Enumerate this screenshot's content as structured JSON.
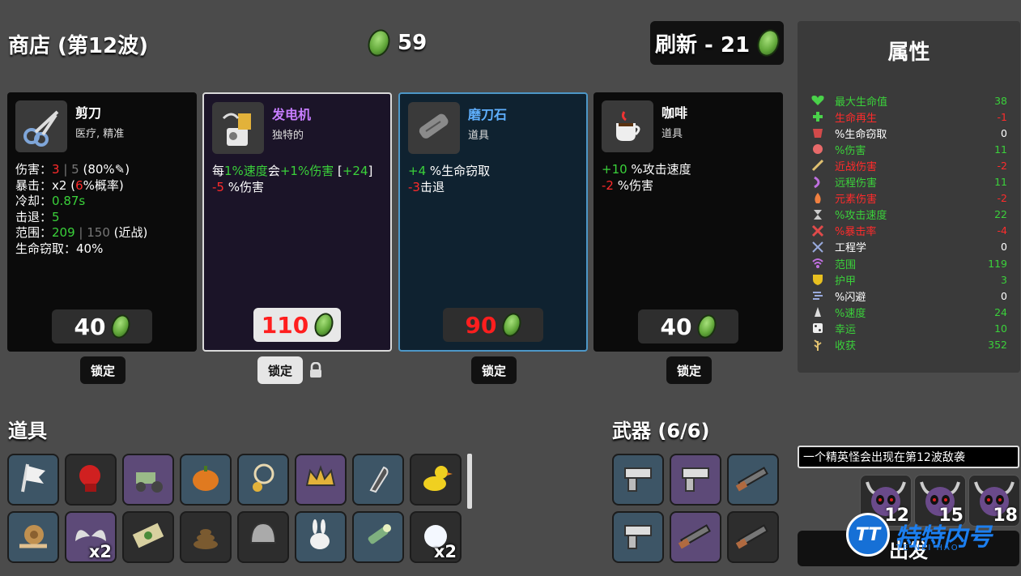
{
  "header": {
    "title": "商店 (第12波)",
    "gold": "59",
    "reroll_label": "刷新 - 21"
  },
  "shop": [
    {
      "name": "剪刀",
      "tags": "医疗, 精准",
      "icon": "scissors-icon",
      "price": "40",
      "lock_label": "锁定",
      "locked": false,
      "rarity": "common",
      "stats": [
        {
          "label": "伤害：",
          "parts": [
            {
              "t": "3",
              "c": "r"
            },
            {
              "t": " | ",
              "c": "dim"
            },
            {
              "t": "5",
              "c": "dim"
            },
            {
              "t": " (80%",
              "c": ""
            },
            {
              "t": "✎",
              "c": ""
            },
            {
              "t": ")",
              "c": ""
            }
          ]
        },
        {
          "label": "暴击：",
          "parts": [
            {
              "t": "x2 (",
              "c": ""
            },
            {
              "t": "6",
              "c": "r"
            },
            {
              "t": "%概率)",
              "c": ""
            }
          ]
        },
        {
          "label": "冷却：",
          "parts": [
            {
              "t": "0.87s",
              "c": "g"
            }
          ]
        },
        {
          "label": "击退：",
          "parts": [
            {
              "t": "5",
              "c": "g"
            }
          ]
        },
        {
          "label": "范围：",
          "parts": [
            {
              "t": "209",
              "c": "g"
            },
            {
              "t": " | 150",
              "c": "dim"
            },
            {
              "t": " (近战)",
              "c": ""
            }
          ]
        },
        {
          "label": "生命窃取：",
          "parts": [
            {
              "t": "40%",
              "c": ""
            }
          ]
        }
      ]
    },
    {
      "name": "发电机",
      "tags": "独特的",
      "icon": "generator-icon",
      "price": "110",
      "lock_label": "锁定",
      "locked": true,
      "rarity": "legendary",
      "stats": [
        {
          "label": "",
          "parts": [
            {
              "t": "每",
              "c": ""
            },
            {
              "t": "1%速度",
              "c": "g"
            },
            {
              "t": "会",
              "c": ""
            },
            {
              "t": "+1%伤害",
              "c": "g"
            },
            {
              "t": " [",
              "c": ""
            },
            {
              "t": "+24",
              "c": "g"
            },
            {
              "t": "]",
              "c": ""
            }
          ]
        },
        {
          "label": "",
          "parts": [
            {
              "t": "-5",
              "c": "r"
            },
            {
              "t": " %伤害",
              "c": ""
            }
          ]
        }
      ]
    },
    {
      "name": "磨刀石",
      "tags": "道具",
      "icon": "whetstone-icon",
      "price": "90",
      "lock_label": "锁定",
      "locked": false,
      "rarity": "rare",
      "stats": [
        {
          "label": "",
          "parts": [
            {
              "t": "+4",
              "c": "g"
            },
            {
              "t": " %生命窃取",
              "c": ""
            }
          ]
        },
        {
          "label": "",
          "parts": [
            {
              "t": "-3",
              "c": "r"
            },
            {
              "t": "击退",
              "c": ""
            }
          ]
        }
      ]
    },
    {
      "name": "咖啡",
      "tags": "道具",
      "icon": "coffee-icon",
      "price": "40",
      "lock_label": "锁定",
      "locked": false,
      "rarity": "common",
      "stats": [
        {
          "label": "",
          "parts": [
            {
              "t": "+10",
              "c": "g"
            },
            {
              "t": " %攻击速度",
              "c": ""
            }
          ]
        },
        {
          "label": "",
          "parts": [
            {
              "t": "-2",
              "c": "r"
            },
            {
              "t": " %伤害",
              "c": ""
            }
          ]
        }
      ]
    }
  ],
  "stats_panel": {
    "title": "属性",
    "rows": [
      {
        "icon": "heart-icon",
        "name": "最大生命值",
        "value": "38",
        "color": "green"
      },
      {
        "icon": "regen-icon",
        "name": "生命再生",
        "value": "-1",
        "color": "red"
      },
      {
        "icon": "lifesteal-icon",
        "name": "%生命窃取",
        "value": "0",
        "color": "white"
      },
      {
        "icon": "damage-icon",
        "name": "%伤害",
        "value": "11",
        "color": "green"
      },
      {
        "icon": "melee-icon",
        "name": "近战伤害",
        "value": "-2",
        "color": "red"
      },
      {
        "icon": "ranged-icon",
        "name": "远程伤害",
        "value": "11",
        "color": "green"
      },
      {
        "icon": "elemental-icon",
        "name": "元素伤害",
        "value": "-2",
        "color": "red"
      },
      {
        "icon": "attack-speed-icon",
        "name": "%攻击速度",
        "value": "22",
        "color": "green"
      },
      {
        "icon": "crit-icon",
        "name": "%暴击率",
        "value": "-4",
        "color": "red"
      },
      {
        "icon": "engineering-icon",
        "name": "工程学",
        "value": "0",
        "color": "white"
      },
      {
        "icon": "range-icon",
        "name": "范围",
        "value": "119",
        "color": "green"
      },
      {
        "icon": "armor-icon",
        "name": "护甲",
        "value": "3",
        "color": "green"
      },
      {
        "icon": "dodge-icon",
        "name": "%闪避",
        "value": "0",
        "color": "white"
      },
      {
        "icon": "speed-icon",
        "name": "%速度",
        "value": "24",
        "color": "green"
      },
      {
        "icon": "luck-icon",
        "name": "幸运",
        "value": "10",
        "color": "green"
      },
      {
        "icon": "harvest-icon",
        "name": "收获",
        "value": "352",
        "color": "green"
      }
    ]
  },
  "items": {
    "title": "道具",
    "slots": [
      {
        "icon": "flag-icon",
        "bg": "blue",
        "count": ""
      },
      {
        "icon": "boxing-glove-icon",
        "bg": "dark",
        "count": ""
      },
      {
        "icon": "tractor-icon",
        "bg": "purple",
        "count": ""
      },
      {
        "icon": "pumpkin-icon",
        "bg": "blue",
        "count": ""
      },
      {
        "icon": "pendant-icon",
        "bg": "blue",
        "count": ""
      },
      {
        "icon": "crown-icon",
        "bg": "purple",
        "count": ""
      },
      {
        "icon": "bullet-icon",
        "bg": "blue",
        "count": ""
      },
      {
        "icon": "duck-icon",
        "bg": "dark",
        "count": ""
      },
      {
        "icon": "snail-icon",
        "bg": "blue",
        "count": ""
      },
      {
        "icon": "wings-icon",
        "bg": "purple",
        "count": "x2"
      },
      {
        "icon": "banknote-icon",
        "bg": "dark",
        "count": ""
      },
      {
        "icon": "poop-icon",
        "bg": "dark",
        "count": ""
      },
      {
        "icon": "helmet-icon",
        "bg": "dark",
        "count": ""
      },
      {
        "icon": "rabbit-icon",
        "bg": "blue",
        "count": ""
      },
      {
        "icon": "flashlight-icon",
        "bg": "blue",
        "count": ""
      },
      {
        "icon": "snowball-icon",
        "bg": "dark",
        "count": "x2"
      }
    ]
  },
  "weapons": {
    "title": "武器 (6/6)",
    "slots": [
      {
        "icon": "pistol-icon",
        "bg": "blue"
      },
      {
        "icon": "pistol-icon",
        "bg": "purple"
      },
      {
        "icon": "shotgun-icon",
        "bg": "blue"
      },
      {
        "icon": "pistol-icon",
        "bg": "blue"
      },
      {
        "icon": "shotgun-icon",
        "bg": "purple"
      },
      {
        "icon": "shotgun-icon",
        "bg": "dark"
      }
    ]
  },
  "wave": {
    "notice": "一个精英怪会出现在第12波敌袭",
    "enemies": [
      {
        "icon": "horned-skull-icon",
        "wave": "12"
      },
      {
        "icon": "horned-skull-icon",
        "wave": "15"
      },
      {
        "icon": "horned-skull-icon",
        "wave": "18"
      }
    ],
    "go_label": "出发"
  },
  "watermark": {
    "logo": "TT",
    "text": "特特内号",
    "sub": "TE NEI HAO"
  }
}
